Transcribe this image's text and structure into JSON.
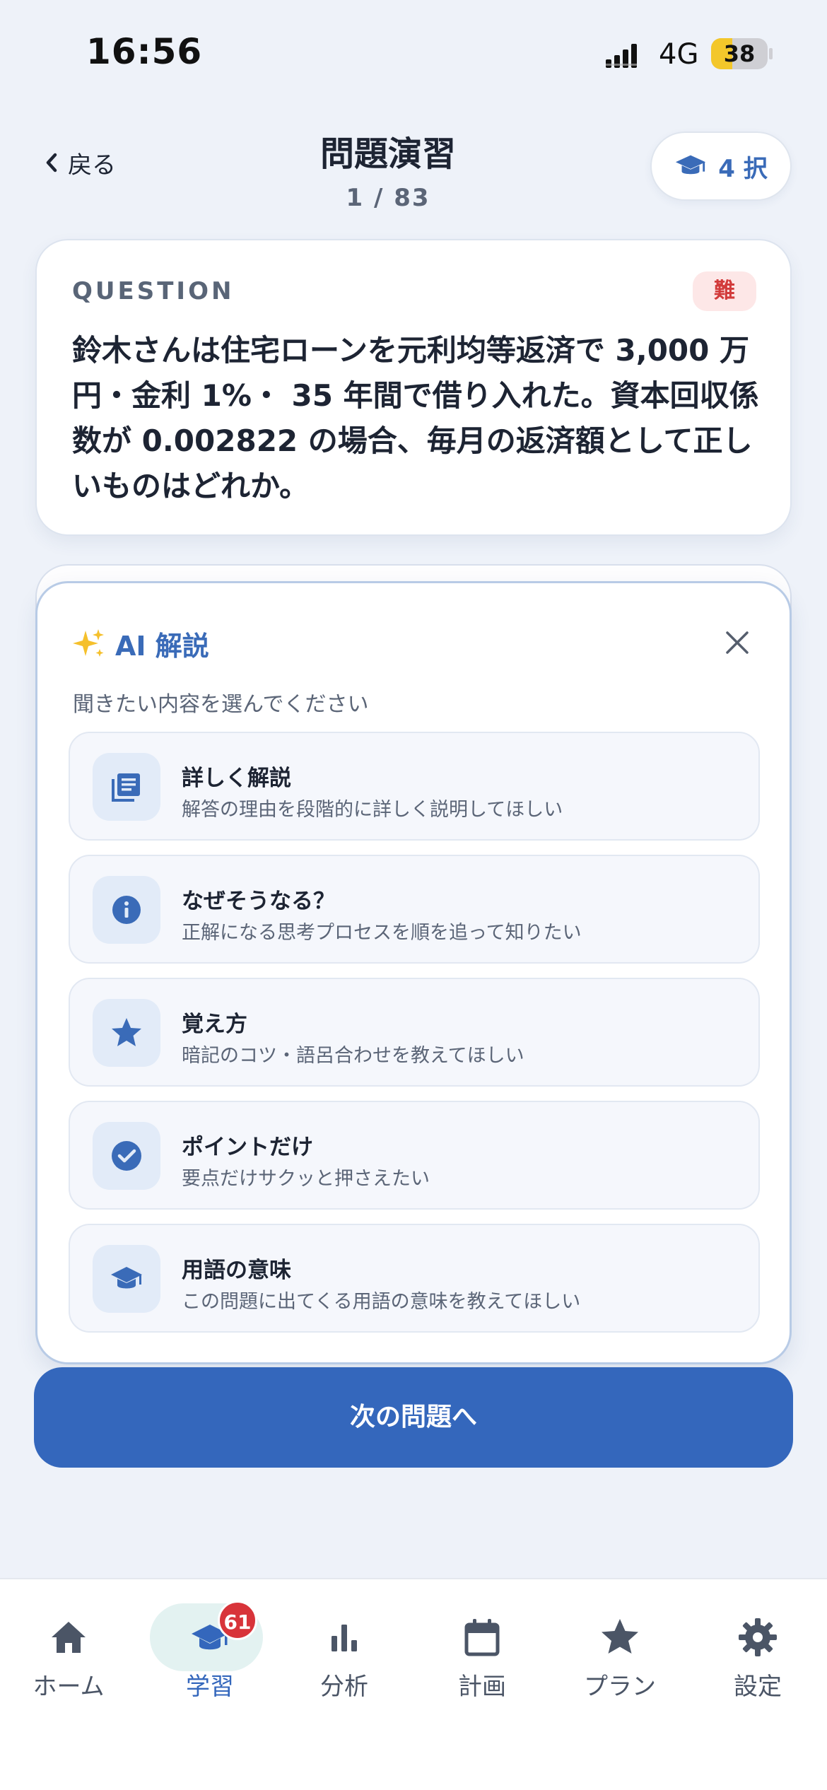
{
  "status_bar": {
    "time": "16:56",
    "network": "4G",
    "battery": "38",
    "battery_level": 0.38,
    "battery_color": "#f3c72b"
  },
  "header": {
    "back_label": "戻る",
    "title": "問題演習",
    "progress": "1 / 83",
    "choices_label": "4 択"
  },
  "question": {
    "label": "QUESTION",
    "difficulty": "難",
    "text": "鈴木さんは住宅ローンを元利均等返済で 3,000 万円・金利 1%・ 35 年間で借り入れた。資本回収係数が 0.002822 の場合、毎月の返済額として正しいものはどれか。"
  },
  "ai_panel": {
    "title": "AI 解説",
    "prompt": "聞きたい内容を選んでください",
    "options": [
      {
        "icon": "document-list-icon",
        "title": "詳しく解説",
        "subtitle": "解答の理由を段階的に詳しく説明してほしい"
      },
      {
        "icon": "info-icon",
        "title": "なぜそうなる？",
        "subtitle": "正解になる思考プロセスを順を追って知りたい"
      },
      {
        "icon": "star-icon",
        "title": "覚え方",
        "subtitle": "暗記のコツ・語呂合わせを教えてほしい"
      },
      {
        "icon": "check-circle-icon",
        "title": "ポイントだけ",
        "subtitle": "要点だけサクッと押さえたい"
      },
      {
        "icon": "graduation-cap-icon",
        "title": "用語の意味",
        "subtitle": "この問題に出てくる用語の意味を教えてほしい"
      }
    ]
  },
  "next_button": "次の問題へ",
  "tabs": [
    {
      "icon": "home-icon",
      "label": "ホーム"
    },
    {
      "icon": "graduation-cap-icon",
      "label": "学習",
      "badge": "61",
      "active": true
    },
    {
      "icon": "bar-chart-icon",
      "label": "分析"
    },
    {
      "icon": "calendar-icon",
      "label": "計画"
    },
    {
      "icon": "star-icon",
      "label": "プラン"
    },
    {
      "icon": "gear-icon",
      "label": "設定"
    }
  ],
  "colors": {
    "accent": "#3467bc",
    "difficulty": "#d23b3b",
    "badge": "#d8343a"
  }
}
